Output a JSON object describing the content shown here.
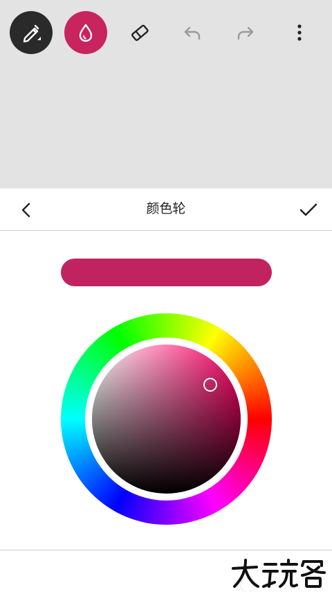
{
  "toolbar": {
    "tools": [
      "pen",
      "color-fill",
      "eraser",
      "undo",
      "redo",
      "more"
    ]
  },
  "panel": {
    "title": "颜色轮"
  },
  "colors": {
    "selected": "#c12360",
    "active_tool_bg": "#c8245d",
    "pen_bg": "#2a2a2a",
    "canvas_bg": "#e4e3e3",
    "hue_base": "#ff0066"
  },
  "watermark": {
    "text": "大玩客"
  }
}
